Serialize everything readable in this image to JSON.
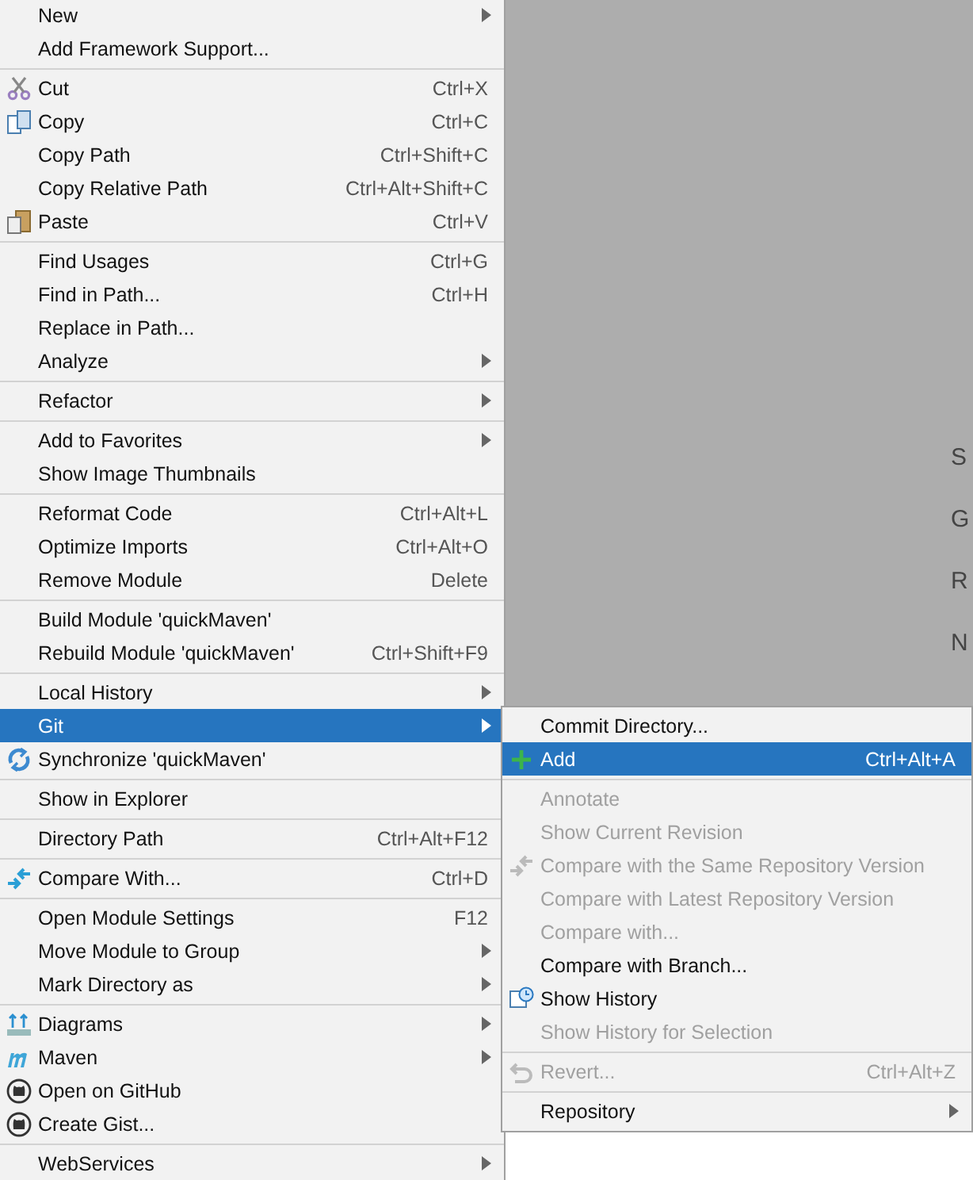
{
  "background": {
    "labels": [
      "S",
      "G",
      "R",
      "N"
    ]
  },
  "context_menu": {
    "sections": [
      {
        "items": [
          {
            "label": "New",
            "submenu": true,
            "kind": "plain",
            "selected": false
          },
          {
            "label": "Add Framework Support...",
            "submenu": false,
            "kind": "plain",
            "selected": false
          }
        ]
      },
      {
        "items": [
          {
            "label": "Cut",
            "shortcut": "Ctrl+X",
            "submenu": false,
            "kind": "scissors",
            "selected": false
          },
          {
            "label": "Copy",
            "shortcut": "Ctrl+C",
            "submenu": false,
            "kind": "copy",
            "selected": false
          },
          {
            "label": "Copy Path",
            "shortcut": "Ctrl+Shift+C",
            "submenu": false,
            "kind": "plain",
            "selected": false
          },
          {
            "label": "Copy Relative Path",
            "shortcut": "Ctrl+Alt+Shift+C",
            "submenu": false,
            "kind": "plain",
            "selected": false
          },
          {
            "label": "Paste",
            "shortcut": "Ctrl+V",
            "submenu": false,
            "kind": "paste",
            "selected": false
          }
        ]
      },
      {
        "items": [
          {
            "label": "Find Usages",
            "shortcut": "Ctrl+G",
            "submenu": false,
            "kind": "plain",
            "selected": false
          },
          {
            "label": "Find in Path...",
            "shortcut": "Ctrl+H",
            "submenu": false,
            "kind": "plain",
            "selected": false
          },
          {
            "label": "Replace in Path...",
            "submenu": false,
            "kind": "plain",
            "selected": false
          },
          {
            "label": "Analyze",
            "submenu": true,
            "kind": "plain",
            "selected": false
          }
        ]
      },
      {
        "items": [
          {
            "label": "Refactor",
            "submenu": true,
            "kind": "plain",
            "selected": false
          }
        ]
      },
      {
        "items": [
          {
            "label": "Add to Favorites",
            "submenu": true,
            "kind": "plain",
            "selected": false
          },
          {
            "label": "Show Image Thumbnails",
            "submenu": false,
            "kind": "plain",
            "selected": false
          }
        ]
      },
      {
        "items": [
          {
            "label": "Reformat Code",
            "shortcut": "Ctrl+Alt+L",
            "submenu": false,
            "kind": "plain",
            "selected": false
          },
          {
            "label": "Optimize Imports",
            "shortcut": "Ctrl+Alt+O",
            "submenu": false,
            "kind": "plain",
            "selected": false
          },
          {
            "label": "Remove Module",
            "shortcut": "Delete",
            "submenu": false,
            "kind": "plain",
            "selected": false
          }
        ]
      },
      {
        "items": [
          {
            "label": "Build Module 'quickMaven'",
            "submenu": false,
            "kind": "plain",
            "selected": false
          },
          {
            "label": "Rebuild Module 'quickMaven'",
            "shortcut": "Ctrl+Shift+F9",
            "submenu": false,
            "kind": "plain",
            "selected": false
          }
        ]
      },
      {
        "items": [
          {
            "label": "Local History",
            "submenu": true,
            "kind": "plain",
            "selected": false
          },
          {
            "label": "Git",
            "submenu": true,
            "kind": "plain",
            "selected": true
          },
          {
            "label": "Synchronize 'quickMaven'",
            "submenu": false,
            "kind": "sync",
            "selected": false
          }
        ]
      },
      {
        "items": [
          {
            "label": "Show in Explorer",
            "submenu": false,
            "kind": "plain",
            "selected": false
          }
        ]
      },
      {
        "items": [
          {
            "label": "Directory Path",
            "shortcut": "Ctrl+Alt+F12",
            "submenu": false,
            "kind": "plain",
            "selected": false
          }
        ]
      },
      {
        "items": [
          {
            "label": "Compare With...",
            "shortcut": "Ctrl+D",
            "submenu": false,
            "kind": "compare",
            "selected": false
          }
        ]
      },
      {
        "items": [
          {
            "label": "Open Module Settings",
            "shortcut": "F12",
            "submenu": false,
            "kind": "plain",
            "selected": false
          },
          {
            "label": "Move Module to Group",
            "submenu": true,
            "kind": "plain",
            "selected": false
          },
          {
            "label": "Mark Directory as",
            "submenu": true,
            "kind": "plain",
            "selected": false
          }
        ]
      },
      {
        "items": [
          {
            "label": "Diagrams",
            "submenu": true,
            "kind": "diagram",
            "selected": false
          },
          {
            "label": "Maven",
            "submenu": true,
            "kind": "maven",
            "selected": false
          },
          {
            "label": "Open on GitHub",
            "submenu": false,
            "kind": "github",
            "selected": false
          },
          {
            "label": "Create Gist...",
            "submenu": false,
            "kind": "github",
            "selected": false
          }
        ]
      },
      {
        "items": [
          {
            "label": "WebServices",
            "submenu": true,
            "kind": "plain",
            "selected": false
          }
        ]
      }
    ]
  },
  "git_submenu": {
    "sections": [
      {
        "items": [
          {
            "label": "Commit Directory...",
            "submenu": false,
            "kind": "plain",
            "selected": false,
            "disabled": false
          },
          {
            "label": "Add",
            "shortcut": "Ctrl+Alt+A",
            "submenu": false,
            "kind": "plus",
            "selected": true,
            "disabled": false
          }
        ]
      },
      {
        "items": [
          {
            "label": "Annotate",
            "submenu": false,
            "kind": "plain",
            "selected": false,
            "disabled": true
          },
          {
            "label": "Show Current Revision",
            "submenu": false,
            "kind": "plain",
            "selected": false,
            "disabled": true
          },
          {
            "label": "Compare with the Same Repository Version",
            "submenu": false,
            "kind": "compare",
            "selected": false,
            "disabled": true
          },
          {
            "label": "Compare with Latest Repository Version",
            "submenu": false,
            "kind": "plain",
            "selected": false,
            "disabled": true
          },
          {
            "label": "Compare with...",
            "submenu": false,
            "kind": "plain",
            "selected": false,
            "disabled": true
          },
          {
            "label": "Compare with Branch...",
            "submenu": false,
            "kind": "plain",
            "selected": false,
            "disabled": false
          },
          {
            "label": "Show History",
            "submenu": false,
            "kind": "history",
            "selected": false,
            "disabled": false
          },
          {
            "label": "Show History for Selection",
            "submenu": false,
            "kind": "plain",
            "selected": false,
            "disabled": true
          }
        ]
      },
      {
        "items": [
          {
            "label": "Revert...",
            "shortcut": "Ctrl+Alt+Z",
            "submenu": false,
            "kind": "revert",
            "selected": false,
            "disabled": true
          }
        ]
      },
      {
        "items": [
          {
            "label": "Repository",
            "submenu": true,
            "kind": "plain",
            "selected": false,
            "disabled": false
          }
        ]
      }
    ]
  }
}
